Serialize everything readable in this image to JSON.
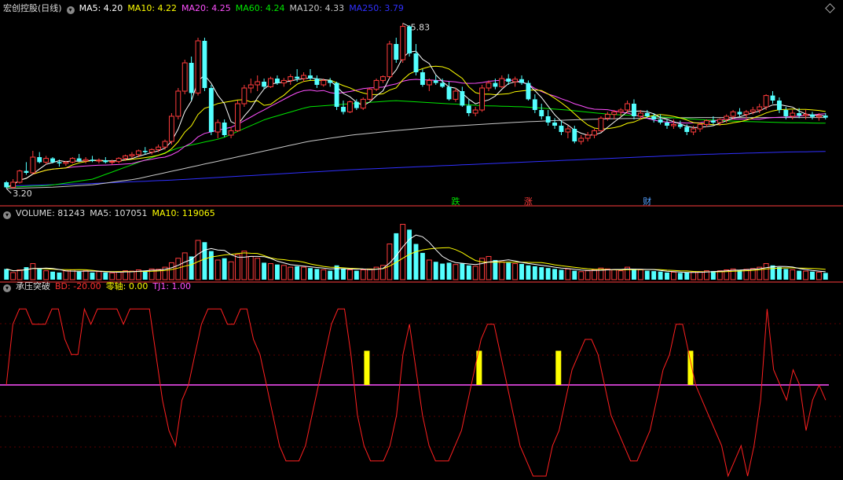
{
  "colors": {
    "up": "#ff3c3c",
    "down": "#54ffff",
    "ma5": "#ffffff",
    "ma10": "#ffff00",
    "ma20": "#ff50ff",
    "ma60": "#00e600",
    "ma120": "#c8c8c8",
    "ma250": "#3030ff",
    "bd": "#ff2020",
    "zero": "#ff50ff",
    "tj": "#ffff00",
    "divider": "#ff3c3c"
  },
  "price_panel": {
    "title": "宏创控股(日线)",
    "ma_legend": [
      {
        "label": "MA5: 4.20",
        "color": "#ffffff"
      },
      {
        "label": "MA10: 4.22",
        "color": "#ffff00"
      },
      {
        "label": "MA20: 4.25",
        "color": "#ff50ff"
      },
      {
        "label": "MA60: 4.24",
        "color": "#00e600"
      },
      {
        "label": "MA120: 4.33",
        "color": "#c8c8c8"
      },
      {
        "label": "MA250: 3.79",
        "color": "#3030ff"
      }
    ],
    "high_label": "5.83",
    "low_label": "3.20",
    "markers": [
      {
        "text": "跌",
        "bar": 68,
        "color": "#00e600"
      },
      {
        "text": "涨",
        "bar": 79,
        "color": "#ff3c3c"
      },
      {
        "text": "财",
        "bar": 97,
        "color": "#54a0ff"
      }
    ]
  },
  "volume_panel": {
    "labels": [
      {
        "text": "VOLUME: 81243",
        "color": "#dddddd"
      },
      {
        "text": "MA5: 107051",
        "color": "#dddddd"
      },
      {
        "text": "MA10: 119065",
        "color": "#ffff00"
      }
    ]
  },
  "indicator_panel": {
    "labels": [
      {
        "text": "承压突破",
        "color": "#dddddd"
      },
      {
        "text": "BD: -20.00",
        "color": "#ff3030"
      },
      {
        "text": "零轴: 0.00",
        "color": "#ffff00"
      },
      {
        "text": "TJ1: 1.00",
        "color": "#ff50ff"
      }
    ]
  },
  "chart_data": [
    {
      "type": "candlestick",
      "title": "宏创控股(日线)",
      "series_names": [
        "MA5",
        "MA10",
        "MA20",
        "MA60",
        "MA120",
        "MA250"
      ],
      "ylim": [
        3.1,
        5.95
      ],
      "max_point": {
        "value": 5.83
      },
      "min_point": {
        "value": 3.2
      },
      "ma60_trend": [
        3.22,
        3.25,
        3.35,
        3.6,
        3.85,
        4.0,
        4.3,
        4.5,
        4.55,
        4.6,
        4.56,
        4.52,
        4.5,
        4.45,
        4.38,
        4.35,
        4.3,
        4.27,
        4.25,
        4.24
      ],
      "ma120_trend": [
        3.2,
        3.22,
        3.26,
        3.35,
        3.5,
        3.65,
        3.8,
        3.95,
        4.05,
        4.12,
        4.18,
        4.22,
        4.26,
        4.29,
        4.31,
        4.32,
        4.33,
        4.33,
        4.33,
        4.33
      ],
      "ma250_trend": [
        3.24,
        3.26,
        3.28,
        3.31,
        3.34,
        3.38,
        3.42,
        3.46,
        3.5,
        3.53,
        3.56,
        3.59,
        3.62,
        3.65,
        3.68,
        3.71,
        3.74,
        3.76,
        3.78,
        3.79
      ],
      "ohlc": [
        [
          3.3,
          3.32,
          3.2,
          3.22
        ],
        [
          3.22,
          3.35,
          3.2,
          3.3
        ],
        [
          3.3,
          3.5,
          3.28,
          3.48
        ],
        [
          3.48,
          3.62,
          3.42,
          3.45
        ],
        [
          3.45,
          3.8,
          3.43,
          3.7
        ],
        [
          3.7,
          3.78,
          3.6,
          3.62
        ],
        [
          3.62,
          3.72,
          3.58,
          3.68
        ],
        [
          3.68,
          3.7,
          3.6,
          3.62
        ],
        [
          3.62,
          3.66,
          3.55,
          3.6
        ],
        [
          3.6,
          3.64,
          3.56,
          3.62
        ],
        [
          3.62,
          3.7,
          3.6,
          3.68
        ],
        [
          3.68,
          3.75,
          3.62,
          3.64
        ],
        [
          3.64,
          3.7,
          3.6,
          3.66
        ],
        [
          3.66,
          3.72,
          3.62,
          3.64
        ],
        [
          3.64,
          3.68,
          3.6,
          3.65
        ],
        [
          3.65,
          3.7,
          3.6,
          3.62
        ],
        [
          3.62,
          3.66,
          3.58,
          3.63
        ],
        [
          3.63,
          3.7,
          3.6,
          3.68
        ],
        [
          3.68,
          3.74,
          3.64,
          3.72
        ],
        [
          3.72,
          3.78,
          3.68,
          3.74
        ],
        [
          3.74,
          3.82,
          3.7,
          3.8
        ],
        [
          3.8,
          3.86,
          3.74,
          3.78
        ],
        [
          3.78,
          3.84,
          3.74,
          3.82
        ],
        [
          3.82,
          3.9,
          3.78,
          3.86
        ],
        [
          3.86,
          3.98,
          3.82,
          3.95
        ],
        [
          3.95,
          4.4,
          3.9,
          4.35
        ],
        [
          4.35,
          4.8,
          4.3,
          4.75
        ],
        [
          4.75,
          5.25,
          4.7,
          5.2
        ],
        [
          5.2,
          5.3,
          4.6,
          4.72
        ],
        [
          4.72,
          5.6,
          4.68,
          5.55
        ],
        [
          5.55,
          5.6,
          4.75,
          4.8
        ],
        [
          4.8,
          4.85,
          4.05,
          4.1
        ],
        [
          4.1,
          4.3,
          4.0,
          4.25
        ],
        [
          4.25,
          4.3,
          4.02,
          4.05
        ],
        [
          4.05,
          4.18,
          4.0,
          4.12
        ],
        [
          4.12,
          4.6,
          4.1,
          4.55
        ],
        [
          4.55,
          4.85,
          4.5,
          4.8
        ],
        [
          4.8,
          4.95,
          4.72,
          4.85
        ],
        [
          4.85,
          5.0,
          4.75,
          4.9
        ],
        [
          4.9,
          4.95,
          4.78,
          4.82
        ],
        [
          4.82,
          4.98,
          4.8,
          4.95
        ],
        [
          4.95,
          5.0,
          4.85,
          4.88
        ],
        [
          4.88,
          4.96,
          4.82,
          4.92
        ],
        [
          4.92,
          5.02,
          4.85,
          4.98
        ],
        [
          4.98,
          5.1,
          4.9,
          4.95
        ],
        [
          4.95,
          5.05,
          4.9,
          5.0
        ],
        [
          5.0,
          5.1,
          4.92,
          4.95
        ],
        [
          4.95,
          5.0,
          4.8,
          4.85
        ],
        [
          4.85,
          4.95,
          4.82,
          4.92
        ],
        [
          4.92,
          4.96,
          4.82,
          4.88
        ],
        [
          4.88,
          4.9,
          4.45,
          4.5
        ],
        [
          4.5,
          4.6,
          4.38,
          4.42
        ],
        [
          4.42,
          4.6,
          4.4,
          4.58
        ],
        [
          4.58,
          4.62,
          4.45,
          4.48
        ],
        [
          4.48,
          4.65,
          4.45,
          4.62
        ],
        [
          4.62,
          4.8,
          4.6,
          4.78
        ],
        [
          4.78,
          4.95,
          4.75,
          4.92
        ],
        [
          4.92,
          5.0,
          4.88,
          4.98
        ],
        [
          4.98,
          5.55,
          4.95,
          5.5
        ],
        [
          5.5,
          5.6,
          5.2,
          5.25
        ],
        [
          5.25,
          5.83,
          5.2,
          5.78
        ],
        [
          5.78,
          5.8,
          5.3,
          5.35
        ],
        [
          5.35,
          5.5,
          5.0,
          5.05
        ],
        [
          5.05,
          5.1,
          4.82,
          4.85
        ],
        [
          4.85,
          4.95,
          4.75,
          4.92
        ],
        [
          4.92,
          5.0,
          4.85,
          4.88
        ],
        [
          4.88,
          4.95,
          4.8,
          4.82
        ],
        [
          4.82,
          4.9,
          4.6,
          4.62
        ],
        [
          4.62,
          4.8,
          4.58,
          4.75
        ],
        [
          4.75,
          4.82,
          4.5,
          4.52
        ],
        [
          4.52,
          4.62,
          4.35,
          4.4
        ],
        [
          4.4,
          4.5,
          4.35,
          4.45
        ],
        [
          4.45,
          4.85,
          4.42,
          4.8
        ],
        [
          4.8,
          4.92,
          4.75,
          4.88
        ],
        [
          4.88,
          4.95,
          4.78,
          4.82
        ],
        [
          4.82,
          5.0,
          4.8,
          4.95
        ],
        [
          4.95,
          5.02,
          4.85,
          4.9
        ],
        [
          4.9,
          4.98,
          4.82,
          4.94
        ],
        [
          4.94,
          5.0,
          4.85,
          4.88
        ],
        [
          4.88,
          4.92,
          4.6,
          4.62
        ],
        [
          4.62,
          4.7,
          4.4,
          4.45
        ],
        [
          4.45,
          4.55,
          4.3,
          4.35
        ],
        [
          4.35,
          4.45,
          4.2,
          4.25
        ],
        [
          4.25,
          4.32,
          4.15,
          4.2
        ],
        [
          4.2,
          4.28,
          4.05,
          4.1
        ],
        [
          4.1,
          4.2,
          4.0,
          4.15
        ],
        [
          4.15,
          4.2,
          3.92,
          3.95
        ],
        [
          3.95,
          4.05,
          3.9,
          4.0
        ],
        [
          4.0,
          4.1,
          3.95,
          4.05
        ],
        [
          4.05,
          4.15,
          4.0,
          4.12
        ],
        [
          4.12,
          4.35,
          4.1,
          4.32
        ],
        [
          4.32,
          4.42,
          4.28,
          4.38
        ],
        [
          4.38,
          4.45,
          4.3,
          4.42
        ],
        [
          4.42,
          4.48,
          4.35,
          4.45
        ],
        [
          4.45,
          4.6,
          4.4,
          4.55
        ],
        [
          4.55,
          4.62,
          4.3,
          4.35
        ],
        [
          4.35,
          4.45,
          4.3,
          4.4
        ],
        [
          4.4,
          4.45,
          4.32,
          4.35
        ],
        [
          4.35,
          4.4,
          4.25,
          4.3
        ],
        [
          4.3,
          4.38,
          4.22,
          4.25
        ],
        [
          4.25,
          4.3,
          4.15,
          4.2
        ],
        [
          4.2,
          4.3,
          4.15,
          4.22
        ],
        [
          4.22,
          4.28,
          4.15,
          4.18
        ],
        [
          4.18,
          4.22,
          4.05,
          4.1
        ],
        [
          4.1,
          4.2,
          4.05,
          4.15
        ],
        [
          4.15,
          4.25,
          4.1,
          4.22
        ],
        [
          4.22,
          4.3,
          4.18,
          4.28
        ],
        [
          4.28,
          4.35,
          4.22,
          4.25
        ],
        [
          4.25,
          4.32,
          4.2,
          4.3
        ],
        [
          4.3,
          4.38,
          4.25,
          4.35
        ],
        [
          4.35,
          4.45,
          4.3,
          4.42
        ],
        [
          4.42,
          4.48,
          4.35,
          4.38
        ],
        [
          4.38,
          4.45,
          4.32,
          4.42
        ],
        [
          4.42,
          4.5,
          4.38,
          4.45
        ],
        [
          4.45,
          4.55,
          4.4,
          4.5
        ],
        [
          4.5,
          4.7,
          4.45,
          4.68
        ],
        [
          4.68,
          4.75,
          4.55,
          4.6
        ],
        [
          4.6,
          4.65,
          4.4,
          4.45
        ],
        [
          4.45,
          4.5,
          4.3,
          4.35
        ],
        [
          4.35,
          4.45,
          4.3,
          4.4
        ],
        [
          4.4,
          4.48,
          4.32,
          4.36
        ],
        [
          4.36,
          4.45,
          4.3,
          4.38
        ],
        [
          4.38,
          4.42,
          4.3,
          4.34
        ],
        [
          4.34,
          4.4,
          4.28,
          4.36
        ],
        [
          4.36,
          4.4,
          4.3,
          4.33
        ]
      ]
    },
    {
      "type": "bar",
      "title": "VOLUME",
      "series": [
        {
          "name": "VOLUME",
          "values": [
            60,
            40,
            55,
            70,
            90,
            60,
            50,
            45,
            40,
            50,
            55,
            45,
            50,
            40,
            45,
            40,
            38,
            45,
            50,
            48,
            55,
            50,
            60,
            58,
            70,
            95,
            120,
            150,
            130,
            220,
            210,
            160,
            110,
            120,
            100,
            140,
            160,
            130,
            120,
            95,
            90,
            85,
            80,
            70,
            75,
            70,
            65,
            60,
            55,
            50,
            80,
            60,
            55,
            50,
            55,
            60,
            70,
            80,
            200,
            260,
            310,
            280,
            200,
            150,
            110,
            100,
            90,
            95,
            85,
            90,
            80,
            75,
            120,
            130,
            110,
            100,
            95,
            90,
            88,
            80,
            75,
            70,
            65,
            60,
            55,
            60,
            50,
            45,
            50,
            55,
            65,
            60,
            55,
            50,
            70,
            60,
            55,
            50,
            48,
            45,
            40,
            42,
            38,
            40,
            42,
            45,
            50,
            48,
            50,
            55,
            60,
            55,
            58,
            62,
            70,
            90,
            80,
            70,
            60,
            55,
            50,
            48,
            45,
            42,
            38
          ]
        },
        {
          "name": "MA5",
          "values": []
        },
        {
          "name": "MA10",
          "values": []
        }
      ],
      "latest": {
        "VOLUME": 81243,
        "MA5": 107051,
        "MA10": 119065
      }
    },
    {
      "type": "line",
      "title": "承压突破",
      "series": [
        {
          "name": "BD",
          "latest": -20.0
        },
        {
          "name": "零轴",
          "latest": 0.0
        },
        {
          "name": "TJ1",
          "latest": 1.0
        }
      ],
      "ylim": [
        -120,
        120
      ],
      "bd_values": [
        0,
        80,
        100,
        100,
        80,
        80,
        80,
        100,
        100,
        60,
        40,
        40,
        100,
        80,
        100,
        100,
        100,
        100,
        80,
        100,
        100,
        100,
        100,
        40,
        -20,
        -60,
        -80,
        -20,
        0,
        40,
        80,
        100,
        100,
        100,
        80,
        80,
        100,
        100,
        60,
        40,
        0,
        -40,
        -80,
        -100,
        -100,
        -100,
        -80,
        -40,
        0,
        40,
        80,
        100,
        100,
        40,
        -40,
        -80,
        -100,
        -100,
        -100,
        -80,
        -40,
        40,
        80,
        20,
        -40,
        -80,
        -100,
        -100,
        -100,
        -80,
        -60,
        -20,
        20,
        60,
        80,
        80,
        40,
        0,
        -40,
        -80,
        -100,
        -120,
        -120,
        -120,
        -80,
        -60,
        -20,
        20,
        40,
        60,
        60,
        40,
        0,
        -40,
        -60,
        -80,
        -100,
        -100,
        -80,
        -60,
        -20,
        20,
        40,
        80,
        80,
        40,
        0,
        -20,
        -40,
        -60,
        -80,
        -120,
        -100,
        -80,
        -120,
        -80,
        -20,
        100,
        20,
        0,
        -20,
        20,
        0,
        -60,
        -20,
        0,
        -20
      ],
      "tj1_bars": [
        55,
        72,
        84,
        104
      ]
    }
  ]
}
